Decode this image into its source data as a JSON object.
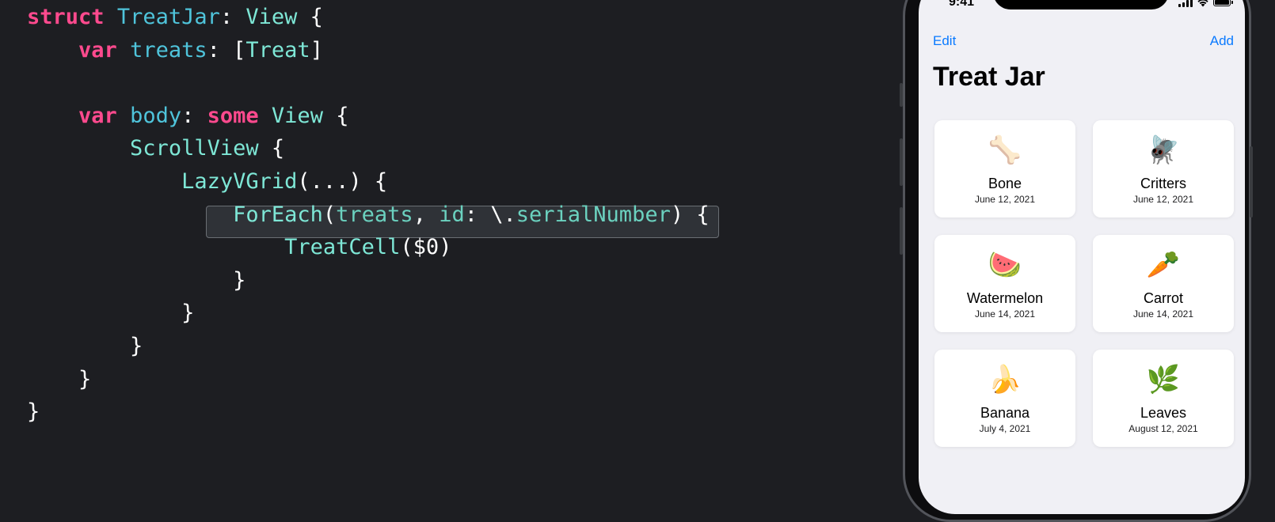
{
  "code": {
    "lines": [
      [
        {
          "t": "struct",
          "c": "kw"
        },
        {
          "t": " ",
          "c": "plain"
        },
        {
          "t": "TreatJar",
          "c": "id"
        },
        {
          "t": ": ",
          "c": "plain"
        },
        {
          "t": "View",
          "c": "type"
        },
        {
          "t": " {",
          "c": "plain"
        }
      ],
      [
        {
          "t": "    ",
          "c": "plain"
        },
        {
          "t": "var",
          "c": "kw"
        },
        {
          "t": " ",
          "c": "plain"
        },
        {
          "t": "treats",
          "c": "id"
        },
        {
          "t": ": [",
          "c": "plain"
        },
        {
          "t": "Treat",
          "c": "type"
        },
        {
          "t": "]",
          "c": "plain"
        }
      ],
      [],
      [
        {
          "t": "    ",
          "c": "plain"
        },
        {
          "t": "var",
          "c": "kw"
        },
        {
          "t": " ",
          "c": "plain"
        },
        {
          "t": "body",
          "c": "id"
        },
        {
          "t": ": ",
          "c": "plain"
        },
        {
          "t": "some",
          "c": "kw"
        },
        {
          "t": " ",
          "c": "plain"
        },
        {
          "t": "View",
          "c": "type"
        },
        {
          "t": " {",
          "c": "plain"
        }
      ],
      [
        {
          "t": "        ",
          "c": "plain"
        },
        {
          "t": "ScrollView",
          "c": "type"
        },
        {
          "t": " {",
          "c": "plain"
        }
      ],
      [
        {
          "t": "            ",
          "c": "plain"
        },
        {
          "t": "LazyVGrid",
          "c": "type"
        },
        {
          "t": "(...) {",
          "c": "plain"
        }
      ],
      [
        {
          "t": "                ",
          "c": "plain"
        },
        {
          "t": "ForEach",
          "c": "type"
        },
        {
          "t": "(",
          "c": "plain"
        },
        {
          "t": "treats",
          "c": "prop"
        },
        {
          "t": ", ",
          "c": "plain"
        },
        {
          "t": "id",
          "c": "prop"
        },
        {
          "t": ": \\.",
          "c": "plain"
        },
        {
          "t": "serialNumber",
          "c": "prop"
        },
        {
          "t": ") {",
          "c": "plain"
        }
      ],
      [
        {
          "t": "                    ",
          "c": "plain"
        },
        {
          "t": "TreatCell",
          "c": "type"
        },
        {
          "t": "($0)",
          "c": "plain"
        }
      ],
      [
        {
          "t": "                }",
          "c": "plain"
        }
      ],
      [
        {
          "t": "            }",
          "c": "plain"
        }
      ],
      [
        {
          "t": "        }",
          "c": "plain"
        }
      ],
      [
        {
          "t": "    }",
          "c": "plain"
        }
      ],
      [
        {
          "t": "}",
          "c": "plain"
        }
      ]
    ],
    "colors": {
      "keyword": "#ff4a8e",
      "type": "#7ee7d6",
      "identifier": "#4fc4db",
      "property": "#6bd1bf",
      "background": "#1d1e22"
    }
  },
  "phone": {
    "status_time": "9:41",
    "nav_left": "Edit",
    "nav_right": "Add",
    "title": "Treat Jar",
    "accent_color": "#0a7aff",
    "treats": [
      {
        "icon": "🦴",
        "icon_name": "bone-icon",
        "name": "Bone",
        "date": "June 12, 2021"
      },
      {
        "icon": "🪰",
        "icon_name": "fly-icon",
        "name": "Critters",
        "date": "June 12, 2021"
      },
      {
        "icon": "🍉",
        "icon_name": "watermelon-icon",
        "name": "Watermelon",
        "date": "June 14, 2021"
      },
      {
        "icon": "🥕",
        "icon_name": "carrot-icon",
        "name": "Carrot",
        "date": "June 14, 2021"
      },
      {
        "icon": "🍌",
        "icon_name": "banana-icon",
        "name": "Banana",
        "date": "July 4, 2021"
      },
      {
        "icon": "🌿",
        "icon_name": "leaves-icon",
        "name": "Leaves",
        "date": "August 12, 2021"
      }
    ]
  }
}
